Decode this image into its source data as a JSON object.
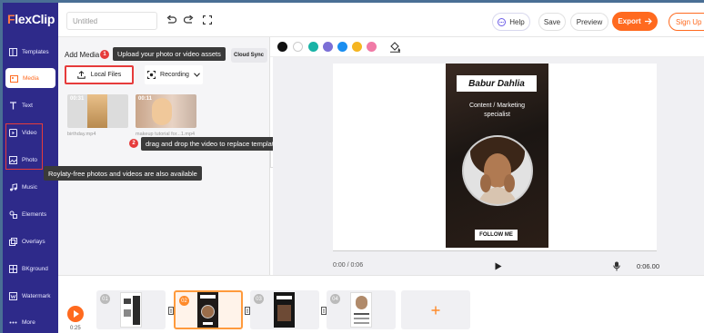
{
  "app": {
    "logo_prefix": "F",
    "logo_rest": "lexClip",
    "title_placeholder": "Untitled"
  },
  "header": {
    "help": "Help",
    "save": "Save",
    "preview": "Preview",
    "export": "Export",
    "signup": "Sign Up"
  },
  "sidebar": {
    "items": [
      {
        "label": "Templates",
        "icon": "templates-icon"
      },
      {
        "label": "Media",
        "icon": "media-icon"
      },
      {
        "label": "Text",
        "icon": "text-icon"
      },
      {
        "label": "Video",
        "icon": "video-icon"
      },
      {
        "label": "Photo",
        "icon": "photo-icon"
      },
      {
        "label": "Music",
        "icon": "music-icon"
      },
      {
        "label": "Elements",
        "icon": "elements-icon"
      },
      {
        "label": "Overlays",
        "icon": "overlays-icon"
      },
      {
        "label": "BKground",
        "icon": "background-icon"
      },
      {
        "label": "Watermark",
        "icon": "watermark-icon"
      },
      {
        "label": "More",
        "icon": "more-icon"
      }
    ],
    "active": "Media"
  },
  "panel": {
    "title": "Add Media",
    "cloud_tab": "Cloud Sync",
    "local_files": "Local Files",
    "recording": "Recording",
    "media": [
      {
        "duration": "00:31",
        "name": "birthday.mp4"
      },
      {
        "duration": "00:11",
        "name": "makeup tutorial for...1.mp4"
      }
    ]
  },
  "annotations": [
    {
      "num": "1",
      "text": "Upload your photo or video assets"
    },
    {
      "num": "2",
      "text": "drag and drop the video to replace template videos"
    },
    {
      "num": "",
      "text": "Roylaty-free photos and videos are also available"
    }
  ],
  "colors": {
    "swatches": [
      "#111111",
      "#ffffff",
      "#19b3a6",
      "#7b6fd6",
      "#1a8ef0",
      "#f5b521",
      "#f07aa6"
    ],
    "accent": "#ff6a1f",
    "sidebar": "#2e2a8a"
  },
  "canvas": {
    "name": "Babur Dahlia",
    "role_line1": "Content / Marketing",
    "role_line2": "specialist",
    "follow": "FOLLOW ME",
    "time_current": "0:00 / 0:06",
    "time_total": "0:06.00"
  },
  "timeline": {
    "time": "0:25",
    "clips": [
      {
        "num": "01",
        "selected": false
      },
      {
        "num": "02",
        "selected": true
      },
      {
        "num": "03",
        "selected": false
      },
      {
        "num": "04",
        "selected": false
      }
    ]
  }
}
